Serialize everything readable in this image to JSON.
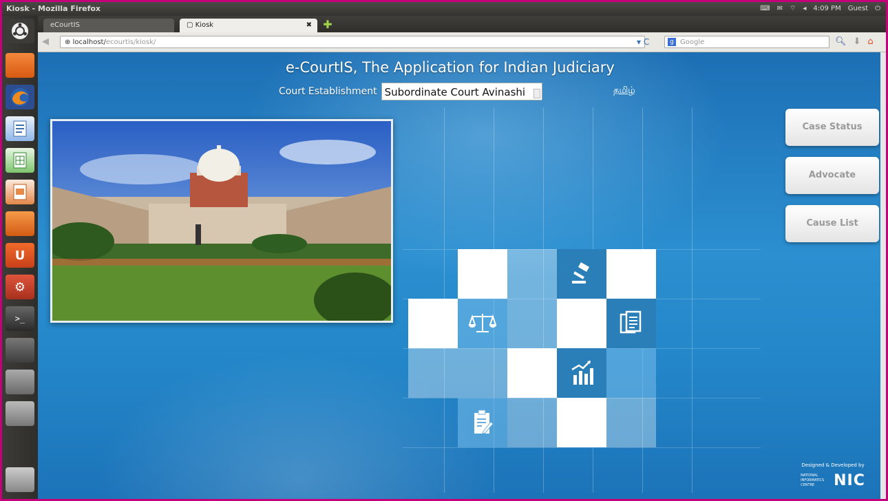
{
  "window": {
    "title": "Kiosk - Mozilla Firefox"
  },
  "tray": {
    "kbd": "⌨",
    "mail": "✉",
    "wifi": "⌔",
    "vol": "◂",
    "time": "4:09 PM",
    "user": "Guest",
    "power": "⏻"
  },
  "browser": {
    "tabs": [
      {
        "label": "eCourtIS",
        "close": ""
      },
      {
        "label": "Kiosk",
        "close": "✖"
      }
    ],
    "new_tab": "✚",
    "url_host": "localhost/",
    "url_path": "ecourtis/kiosk/",
    "reload": "▾ C",
    "search_placeholder": "Google",
    "search_engine": "g"
  },
  "app": {
    "title": "e-CourtIS, The Application for Indian Judiciary",
    "court_label": "Court Establishment",
    "court_value": "Subordinate Court Avinashi",
    "lang_link": "தமிழ்",
    "buttons": {
      "case_status": "Case Status",
      "advocate": "Advocate",
      "cause_list": "Cause List"
    },
    "credit": {
      "line": "Designed & Developed by",
      "org": "NATIONAL INFORMATICS CENTRE",
      "logo": "NIC"
    }
  },
  "icons": {
    "launcher": [
      "ubuntu-icon",
      "files-icon",
      "firefox-icon",
      "writer-icon",
      "calc-icon",
      "impress-icon",
      "software-center-icon",
      "ubuntu-one-icon",
      "settings-icon",
      "terminal-icon",
      "system-monitor-icon",
      "usb-icon",
      "scanner-icon",
      "trash-icon"
    ],
    "tiles": [
      "gavel-icon",
      "scales-icon",
      "documents-icon",
      "chart-icon",
      "clipboard-icon"
    ]
  }
}
